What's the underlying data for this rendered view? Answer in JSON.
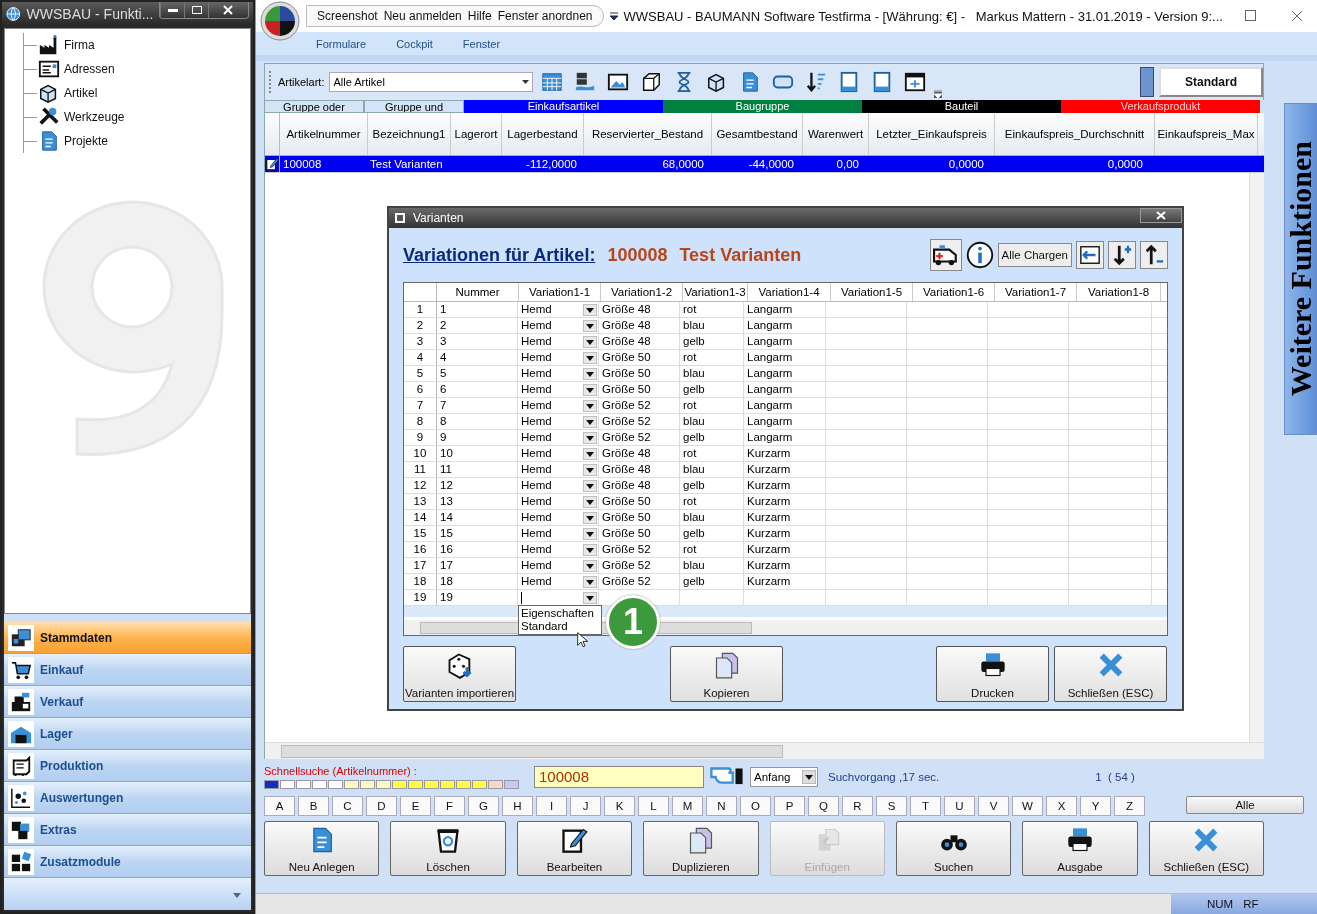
{
  "side_window": {
    "title": "WWSBAU - Funkti...",
    "tree": [
      {
        "label": "Firma"
      },
      {
        "label": "Adressen"
      },
      {
        "label": "Artikel"
      },
      {
        "label": "Werkzeuge"
      },
      {
        "label": "Projekte"
      }
    ],
    "nav": [
      {
        "label": "Stammdaten",
        "selected": true
      },
      {
        "label": "Einkauf",
        "selected": false
      },
      {
        "label": "Verkauf",
        "selected": false
      },
      {
        "label": "Lager",
        "selected": false
      },
      {
        "label": "Produktion",
        "selected": false
      },
      {
        "label": "Auswertungen",
        "selected": false
      },
      {
        "label": "Extras",
        "selected": false
      },
      {
        "label": "Zusatzmodule",
        "selected": false
      }
    ]
  },
  "main_window": {
    "quick_menu": [
      "Screenshot",
      "Neu anmelden",
      "Hilfe",
      "Fenster anordnen"
    ],
    "title": "WWSBAU - BAUMANN Software Testfirma - [Währung: €] -   Markus Mattern - 31.01.2019 - Version 9:...",
    "menu": [
      "Formulare",
      "Cockpit",
      "Fenster"
    ]
  },
  "toolbar": {
    "label": "Artikelart:",
    "value": "Alle Artikel",
    "view_button": "Standard"
  },
  "groups": [
    {
      "label": "Gruppe oder",
      "color": "#d4e4f8"
    },
    {
      "label": "Gruppe und",
      "color": "#d4e4f8"
    },
    {
      "label": "Einkaufsartikel",
      "color": "#0000ff"
    },
    {
      "label": "Baugruppe",
      "color": "#008040"
    },
    {
      "label": "Bauteil",
      "color": "#000000"
    },
    {
      "label": "Verkaufsprodukt",
      "color": "#ff0000"
    }
  ],
  "table": {
    "columns": [
      "Artikelnummer",
      "Bezeichnung1",
      "Lagerort",
      "Lagerbestand",
      "Reservierter_Bestand",
      "Gesamtbestand",
      "Warenwert",
      "Letzter_Einkaufspreis",
      "Einkaufspreis_Durchschnitt",
      "Einkaufspreis_Max"
    ],
    "rows": [
      {
        "selected": true,
        "cells": [
          "100008",
          "Test Varianten",
          "",
          "-112,0000",
          "68,0000",
          "-44,0000",
          "0,00",
          "0,0000",
          "0,0000",
          ""
        ]
      }
    ]
  },
  "dialog": {
    "title": "Varianten",
    "heading": "Variationen für Artikel:",
    "article_number": "100008",
    "article_name": "Test Varianten",
    "chargen_button": "Alle Chargen",
    "columns": [
      "Nummer",
      "Variation1-1",
      "Variation1-2",
      "Variation1-3",
      "Variation1-4",
      "Variation1-5",
      "Variation1-6",
      "Variation1-7",
      "Variation1-8"
    ],
    "rows": [
      {
        "row": "1",
        "cells": [
          "1",
          "Hemd",
          "Größe 48",
          "rot",
          "Langarm"
        ]
      },
      {
        "row": "2",
        "cells": [
          "2",
          "Hemd",
          "Größe 48",
          "blau",
          "Langarm"
        ]
      },
      {
        "row": "3",
        "cells": [
          "3",
          "Hemd",
          "Größe 48",
          "gelb",
          "Langarm"
        ]
      },
      {
        "row": "4",
        "cells": [
          "4",
          "Hemd",
          "Größe 50",
          "rot",
          "Langarm"
        ]
      },
      {
        "row": "5",
        "cells": [
          "5",
          "Hemd",
          "Größe 50",
          "blau",
          "Langarm"
        ]
      },
      {
        "row": "6",
        "cells": [
          "6",
          "Hemd",
          "Größe 50",
          "gelb",
          "Langarm"
        ]
      },
      {
        "row": "7",
        "cells": [
          "7",
          "Hemd",
          "Größe 52",
          "rot",
          "Langarm"
        ]
      },
      {
        "row": "8",
        "cells": [
          "8",
          "Hemd",
          "Größe 52",
          "blau",
          "Langarm"
        ]
      },
      {
        "row": "9",
        "cells": [
          "9",
          "Hemd",
          "Größe 52",
          "gelb",
          "Langarm"
        ]
      },
      {
        "row": "10",
        "cells": [
          "10",
          "Hemd",
          "Größe 48",
          "rot",
          "Kurzarm"
        ]
      },
      {
        "row": "11",
        "cells": [
          "11",
          "Hemd",
          "Größe 48",
          "blau",
          "Kurzarm"
        ]
      },
      {
        "row": "12",
        "cells": [
          "12",
          "Hemd",
          "Größe 48",
          "gelb",
          "Kurzarm"
        ]
      },
      {
        "row": "13",
        "cells": [
          "13",
          "Hemd",
          "Größe 50",
          "rot",
          "Kurzarm"
        ]
      },
      {
        "row": "14",
        "cells": [
          "14",
          "Hemd",
          "Größe 50",
          "blau",
          "Kurzarm"
        ]
      },
      {
        "row": "15",
        "cells": [
          "15",
          "Hemd",
          "Größe 50",
          "gelb",
          "Kurzarm"
        ]
      },
      {
        "row": "16",
        "cells": [
          "16",
          "Hemd",
          "Größe 52",
          "rot",
          "Kurzarm"
        ]
      },
      {
        "row": "17",
        "cells": [
          "17",
          "Hemd",
          "Größe 52",
          "blau",
          "Kurzarm"
        ]
      },
      {
        "row": "18",
        "cells": [
          "18",
          "Hemd",
          "Größe 52",
          "gelb",
          "Kurzarm"
        ]
      },
      {
        "row": "19",
        "cells": [
          "19",
          ""
        ]
      }
    ],
    "dropdown_options": [
      "Eigenschaften",
      "Standard"
    ],
    "step_badge": "1",
    "buttons": [
      {
        "label": "Varianten importieren"
      },
      {
        "label": "Kopieren"
      },
      {
        "label": "Drucken"
      },
      {
        "label": "Schließen (ESC)"
      }
    ]
  },
  "quick_search": {
    "label": "Schnellsuche (Artikelnummer) :",
    "value": "100008",
    "mode": "Anfang",
    "duration": "Suchvorgang ,17 sec.",
    "count": "1  ( 54 )"
  },
  "letters": [
    "A",
    "B",
    "C",
    "D",
    "E",
    "F",
    "G",
    "H",
    "I",
    "J",
    "K",
    "L",
    "M",
    "N",
    "O",
    "P",
    "Q",
    "R",
    "S",
    "T",
    "U",
    "V",
    "W",
    "X",
    "Y",
    "Z"
  ],
  "all_button": "Alle",
  "actions": [
    {
      "label": "Neu Anlegen",
      "disabled": false
    },
    {
      "label": "Löschen",
      "disabled": false
    },
    {
      "label": "Bearbeiten",
      "disabled": false
    },
    {
      "label": "Duplizieren",
      "disabled": false
    },
    {
      "label": "Einfügen",
      "disabled": true
    },
    {
      "label": "Suchen",
      "disabled": false
    },
    {
      "label": "Ausgabe",
      "disabled": false
    },
    {
      "label": "Schließen (ESC)",
      "disabled": false
    }
  ],
  "side_tab": "Weitere Funktionen",
  "status_bar": [
    "NUM",
    "RF"
  ]
}
